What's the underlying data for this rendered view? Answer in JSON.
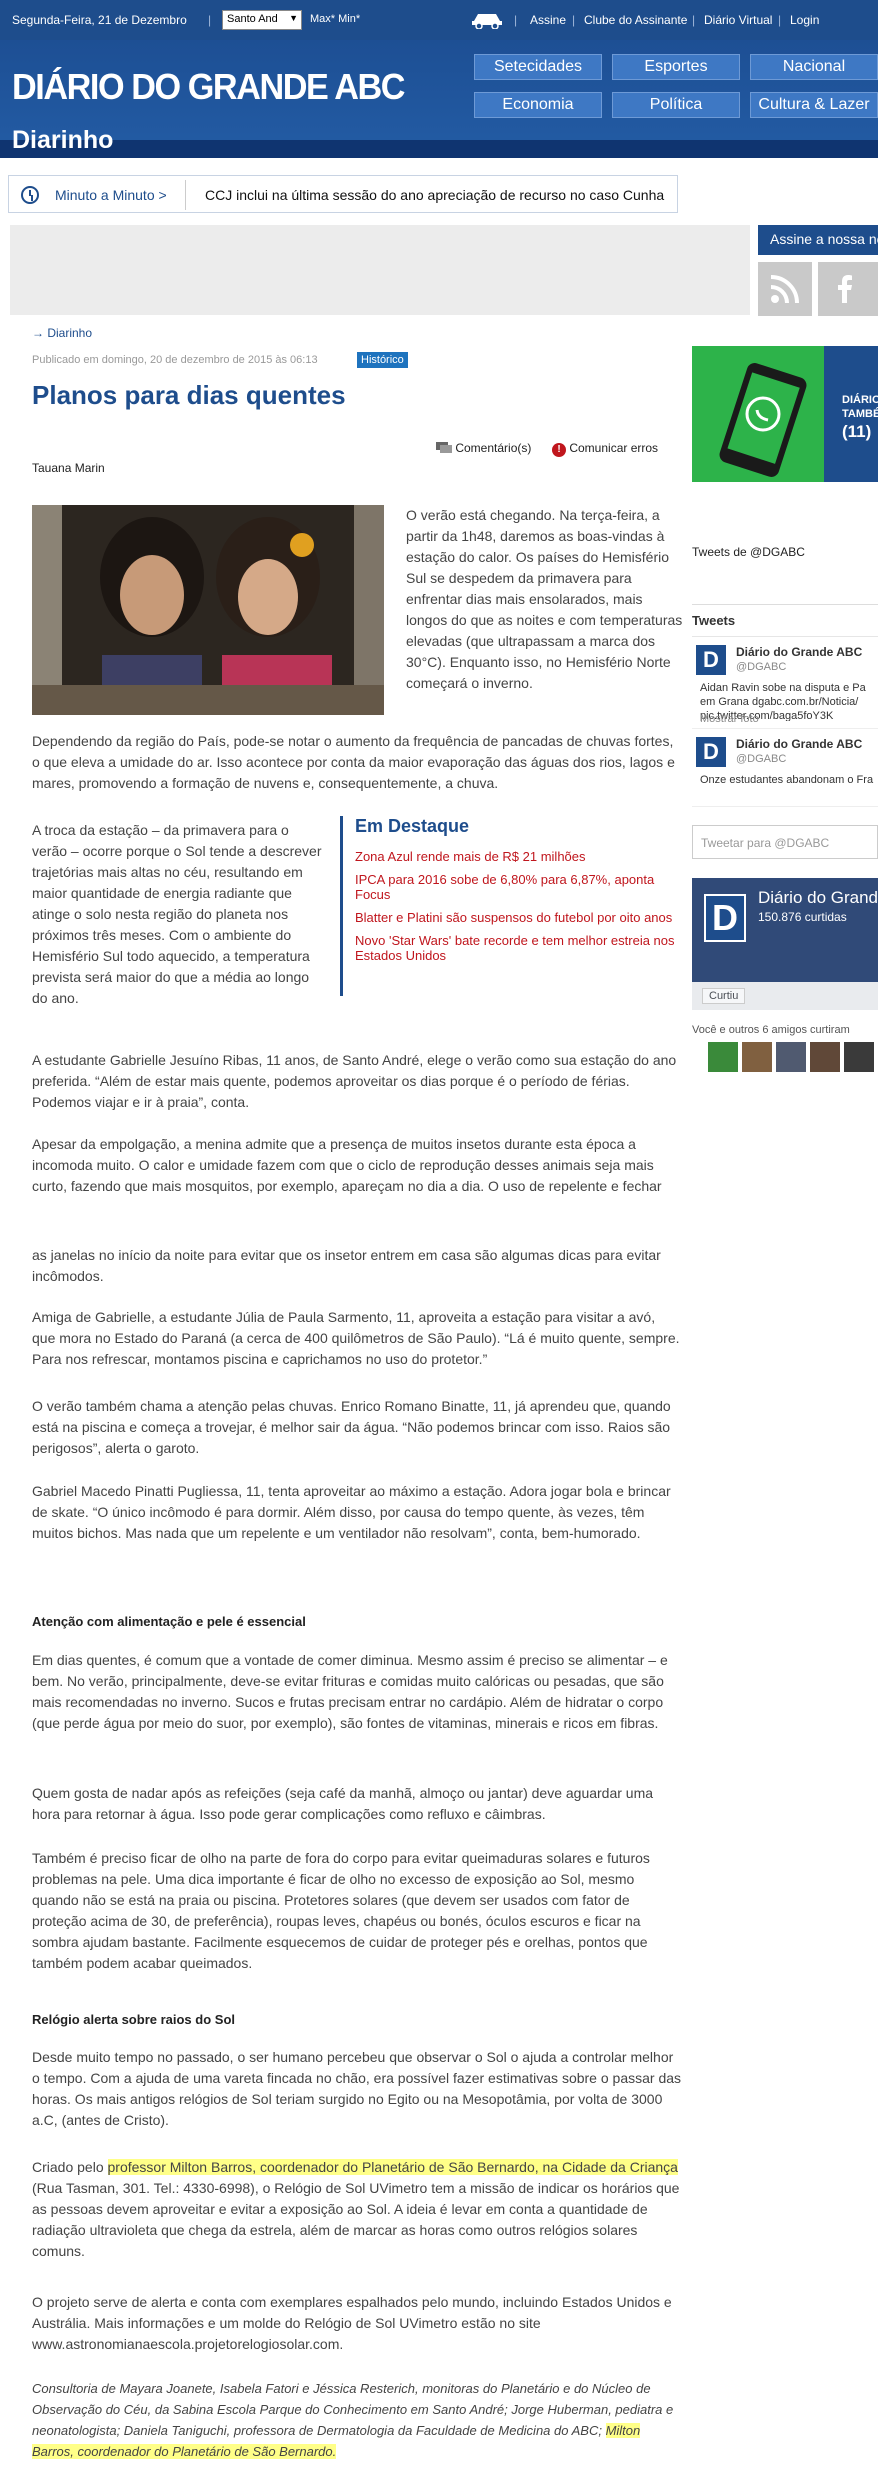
{
  "topbar": {
    "date": "Segunda-Feira, 21 de Dezembro",
    "city": "Santo And",
    "temp": "Max* Min*",
    "links": [
      "Assine",
      "Clube do Assinante",
      "Diário Virtual",
      "Login"
    ]
  },
  "header": {
    "logo": "DIÁRIO DO GRANDE ABC",
    "sections": [
      "Setecidades",
      "Esportes",
      "Nacional",
      "Economia",
      "Política",
      "Cultura & Lazer"
    ],
    "channel": "Diarinho"
  },
  "ticker": {
    "label": "Minuto a Minuto >",
    "headline": "CCJ inclui na última sessão do ano apreciação de recurso no caso Cunha"
  },
  "sidebar_top": {
    "subscribe": "Assine a nossa ne"
  },
  "article": {
    "breadcrumb": "→ Diarinho",
    "published": "Publicado em domingo, 20 de dezembro de 2015 às 06:13",
    "badge": "Histórico",
    "title": "Planos para dias quentes",
    "comments": "Comentário(s)",
    "report": "Comunicar erros",
    "author": "Tauana Marin",
    "p1": "O verão está chegando. Na terça-feira, a partir da 1h48, daremos as boas-vindas à estação do calor. Os países do Hemisfério Sul se despedem da primavera para enfrentar dias mais ensolarados, mais longos do que as noites e com temperaturas elevadas (que ultrapassam a marca dos 30°C). Enquanto isso, no Hemisfério Norte começará o inverno.",
    "p2": "Dependendo da região do País, pode-se notar o aumento da frequência de pancadas de chuvas fortes, o que eleva a umidade do ar. Isso acontece por conta da maior evaporação das águas dos rios, lagos e mares, promovendo a formação de nuvens e, consequentemente, a chuva.",
    "p3": "A troca da estação – da primavera para o verão – ocorre porque o Sol tende a descrever trajetórias mais altas no céu, resultando em maior quantidade de energia radiante que atinge o solo nesta região do planeta nos próximos três meses. Com o ambiente do Hemisfério Sul todo aquecido, a temperatura prevista será maior do que a média ao longo do ano.",
    "p4": "A estudante Gabrielle Jesuíno Ribas, 11 anos, de Santo André, elege o verão como sua estação do ano preferida. “Além de estar mais quente, podemos aproveitar os dias porque é o período de férias. Podemos viajar e ir à praia”, conta.",
    "p5": "Apesar da empolgação, a menina admite que a presença de muitos insetos durante esta época a incomoda muito. O calor e umidade fazem com que o ciclo de reprodução desses animais seja mais curto, fazendo que mais mosquitos, por exemplo, apareçam no dia a dia. O uso de repelente e fechar",
    "p6": "as janelas no início da noite para evitar que os insetor entrem em casa são algumas dicas para evitar incômodos.",
    "p7": "Amiga de Gabrielle, a estudante Júlia de Paula Sarmento, 11, aproveita a estação para visitar a avó, que mora no Estado do Paraná (a cerca de 400 quilômetros de São Paulo). “Lá é muito quente, sempre. Para nos refrescar, montamos piscina e caprichamos no uso do protetor.”",
    "p8": "O verão também chama a atenção pelas chuvas. Enrico Romano Binatte, 11, já aprendeu que, quando está na piscina e começa a trovejar, é melhor sair da água. “Não podemos brincar com isso. Raios são perigosos”, alerta o garoto.",
    "p9": "Gabriel Macedo Pinatti Pugliessa, 11, tenta aproveitar ao máximo a estação. Adora jogar bola e brincar de skate. “O único incômodo é para dormir. Além disso, por causa do tempo quente, às vezes, têm muitos bichos. Mas nada que um repelente e um ventilador não resolvam”, conta, bem-humorado.",
    "sub1": "Atenção com alimentação e pele é essencial",
    "p10": "Em dias quentes, é comum que a vontade de comer diminua. Mesmo assim é preciso se alimentar – e bem. No verão, principalmente, deve-se evitar frituras e comidas muito calóricas ou pesadas, que são mais recomendadas no inverno. Sucos e frutas precisam entrar no cardápio. Além de hidratar o corpo (que perde água por meio do suor, por exemplo), são fontes de vitaminas, minerais e ricos em fibras.",
    "p11": "Quem gosta de nadar após as refeições (seja café da manhã, almoço ou jantar) deve aguardar uma hora para retornar à água. Isso pode gerar complicações como refluxo e câimbras.",
    "p12": "Também é preciso ficar de olho na parte de fora do corpo para evitar queimaduras solares e futuros problemas na pele. Uma dica importante é ficar de olho no excesso de exposição ao Sol, mesmo quando não se está na praia ou piscina. Protetores solares (que devem ser usados com fator de proteção acima de 30, de preferência), roupas leves, chapéus ou bonés, óculos escuros e ficar na sombra ajudam bastante. Facilmente esquecemos de cuidar de proteger pés e orelhas, pontos que também podem acabar queimados.",
    "sub2": "Relógio alerta sobre raios do Sol",
    "p13": "Desde muito tempo no passado, o ser humano percebeu que observar o Sol o ajuda a controlar melhor o tempo. Com a ajuda de uma vareta fincada no chão, era possível fazer estimativas sobre o passar das horas. Os mais antigos relógios de Sol teriam surgido no Egito ou na Mesopotâmia, por volta de 3000 a.C, (antes de Cristo).",
    "p14_pre": "Criado pelo ",
    "p14_hl": "professor Milton Barros, coordenador do Planetário de São Bernardo, na Cidade da Criança",
    "p14_post": " (Rua Tasman, 301. Tel.: 4330-6998), o Relógio de Sol UVimetro tem a missão de indicar os horários que as pessoas devem aproveitar e evitar a exposição ao Sol. A ideia é levar em conta a quantidade de radiação ultravioleta que chega da estrela, além de marcar as horas como outros relógios solares comuns.",
    "p15": "O projeto serve de alerta e conta com exemplares espalhados pelo mundo, incluindo Estados Unidos e Austrália. Mais informações e um molde do Relógio de Sol UVimetro estão no site www.astronomianaescola.projetorelogiosolar.com.",
    "credit_pre": "Consultoria de Mayara Joanete, Isabela Fatori e Jéssica Resterich, monitoras do Planetário e do Núcleo de Observação do Céu, da Sabina Escola Parque do Conhecimento em Santo André; Jorge Huberman, pediatra e neonatologista; Daniela Taniguchi, professora de Dermatologia da Faculdade de Medicina do ABC; ",
    "credit_hl": "Milton Barros, coordenador do Planetário de São Bernardo."
  },
  "destaque": {
    "title": "Em Destaque",
    "items": [
      "Zona Azul rende mais de R$ 21 milhões",
      "IPCA para 2016 sobe de 6,80% para 6,87%, aponta Focus",
      "Blatter e Platini são suspensos do futebol por oito anos",
      "Novo 'Star Wars' bate recorde e tem melhor estreia nos Estados Unidos"
    ]
  },
  "sidebar": {
    "whatsapp": [
      "DIÁRIO",
      "TAMBÉ",
      "(11)"
    ],
    "tweets_from": "Tweets de @DGABC",
    "tweets_title": "Tweets",
    "tweets": [
      {
        "name": "Diário do Grande ABC",
        "handle": "@DGABC",
        "text": "Aidan Ravin sobe na disputa e Pa em Grana dgabc.com.br/Noticia/ pic.twitter.com/baga5foY3K",
        "extra": "Mostrar foto"
      },
      {
        "name": "Diário do Grande ABC",
        "handle": "@DGABC",
        "text": "Onze estudantes abandonam o Fra",
        "extra": ""
      }
    ],
    "compose": "Tweetar para @DGABC",
    "fb_name": "Diário do Grande",
    "fb_likes": "150.876 curtidas",
    "fb_like_btn": "Curtiu",
    "friends": "Você e outros 6 amigos curtiram"
  }
}
